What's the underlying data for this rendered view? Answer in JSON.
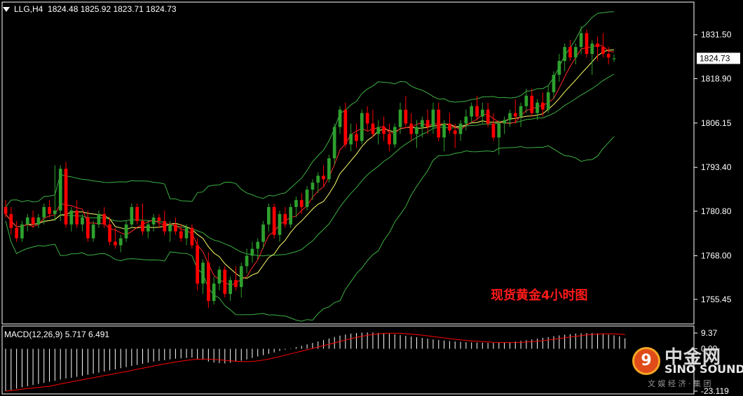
{
  "header": {
    "symbol": "LLG,H4",
    "ohlc": "1824.48 1825.92 1823.71 1824.73"
  },
  "caption": "现货黄金4小时图",
  "macd": {
    "label": "MACD(12,26,9) 5.717 6.491",
    "axis_top": "9.37",
    "axis_zero": "0.00",
    "axis_bottom": "-23.119"
  },
  "logo": {
    "cn": "中金网",
    "en": "SINO SOUND",
    "sub": "文 娱 经 济 · 集 团"
  },
  "colors": {
    "background": "#000000",
    "bull_candle": "#2ea02e",
    "bear_candle": "#ff0000",
    "bollinger": "#3cb043",
    "ma_fast": "#ff2a2a",
    "ma_slow": "#ffff66",
    "macd_hist": "#ffffff",
    "macd_signal": "#ff0000",
    "current_price_box": "#ffffff"
  },
  "chart_data": {
    "type": "candlestick",
    "timeframe": "H4",
    "y_ticks": [
      1831.5,
      1818.9,
      1806.15,
      1793.4,
      1780.8,
      1768.0,
      1755.45
    ],
    "ylim": [
      1748.4,
      1840.9
    ],
    "current_price": 1824.73,
    "candles": [
      [
        1782,
        1784,
        1779,
        1780
      ],
      [
        1780,
        1782,
        1774,
        1776
      ],
      [
        1776,
        1778,
        1772,
        1773
      ],
      [
        1773,
        1778,
        1772,
        1777
      ],
      [
        1777,
        1780,
        1775,
        1779
      ],
      [
        1779,
        1781,
        1776,
        1777
      ],
      [
        1777,
        1780,
        1776,
        1779
      ],
      [
        1779,
        1783,
        1777,
        1782
      ],
      [
        1782,
        1784,
        1779,
        1780
      ],
      [
        1780,
        1794,
        1778,
        1781
      ],
      [
        1781,
        1794,
        1778,
        1793
      ],
      [
        1793,
        1795,
        1776,
        1777
      ],
      [
        1777,
        1782,
        1775,
        1781
      ],
      [
        1781,
        1784,
        1776,
        1777
      ],
      [
        1777,
        1780,
        1775,
        1779
      ],
      [
        1779,
        1781,
        1772,
        1773
      ],
      [
        1773,
        1778,
        1772,
        1777
      ],
      [
        1777,
        1781,
        1776,
        1780
      ],
      [
        1780,
        1782,
        1776,
        1777
      ],
      [
        1777,
        1779,
        1771,
        1772
      ],
      [
        1772,
        1776,
        1770,
        1771
      ],
      [
        1771,
        1774,
        1769,
        1773
      ],
      [
        1773,
        1778,
        1772,
        1777
      ],
      [
        1777,
        1783,
        1776,
        1782
      ],
      [
        1782,
        1783,
        1777,
        1778
      ],
      [
        1778,
        1783,
        1774,
        1775
      ],
      [
        1775,
        1778,
        1773,
        1777
      ],
      [
        1777,
        1780,
        1775,
        1779
      ],
      [
        1779,
        1780,
        1776,
        1778
      ],
      [
        1778,
        1781,
        1774,
        1775
      ],
      [
        1775,
        1778,
        1772,
        1777
      ],
      [
        1777,
        1779,
        1774,
        1775
      ],
      [
        1775,
        1777,
        1772,
        1773
      ],
      [
        1773,
        1777,
        1771,
        1776
      ],
      [
        1776,
        1777,
        1770,
        1771
      ],
      [
        1771,
        1773,
        1758,
        1760
      ],
      [
        1760,
        1767,
        1757,
        1766
      ],
      [
        1766,
        1769,
        1753,
        1755
      ],
      [
        1755,
        1762,
        1754,
        1760
      ],
      [
        1760,
        1765,
        1758,
        1764
      ],
      [
        1764,
        1765,
        1756,
        1757
      ],
      [
        1757,
        1762,
        1755,
        1761
      ],
      [
        1761,
        1765,
        1758,
        1759
      ],
      [
        1759,
        1766,
        1756,
        1765
      ],
      [
        1765,
        1770,
        1763,
        1768
      ],
      [
        1768,
        1772,
        1766,
        1770
      ],
      [
        1770,
        1773,
        1767,
        1772
      ],
      [
        1772,
        1778,
        1770,
        1777
      ],
      [
        1777,
        1783,
        1775,
        1782
      ],
      [
        1782,
        1783,
        1773,
        1774
      ],
      [
        1774,
        1781,
        1772,
        1780
      ],
      [
        1780,
        1782,
        1776,
        1777
      ],
      [
        1777,
        1783,
        1776,
        1782
      ],
      [
        1782,
        1785,
        1779,
        1784
      ],
      [
        1784,
        1786,
        1780,
        1782
      ],
      [
        1782,
        1788,
        1781,
        1787
      ],
      [
        1787,
        1790,
        1784,
        1789
      ],
      [
        1789,
        1792,
        1786,
        1791
      ],
      [
        1791,
        1794,
        1788,
        1790
      ],
      [
        1790,
        1797,
        1789,
        1796
      ],
      [
        1796,
        1806,
        1794,
        1805
      ],
      [
        1805,
        1811,
        1803,
        1810
      ],
      [
        1810,
        1812,
        1799,
        1800
      ],
      [
        1800,
        1806,
        1798,
        1803
      ],
      [
        1803,
        1806,
        1799,
        1801
      ],
      [
        1801,
        1810,
        1800,
        1809
      ],
      [
        1809,
        1811,
        1804,
        1806
      ],
      [
        1806,
        1810,
        1802,
        1803
      ],
      [
        1803,
        1807,
        1800,
        1805
      ],
      [
        1805,
        1808,
        1801,
        1803
      ],
      [
        1803,
        1806,
        1798,
        1800
      ],
      [
        1800,
        1806,
        1799,
        1805
      ],
      [
        1805,
        1812,
        1803,
        1810
      ],
      [
        1810,
        1814,
        1805,
        1806
      ],
      [
        1806,
        1809,
        1801,
        1803
      ],
      [
        1803,
        1807,
        1799,
        1805
      ],
      [
        1805,
        1808,
        1802,
        1807
      ],
      [
        1807,
        1810,
        1803,
        1805
      ],
      [
        1805,
        1812,
        1803,
        1810
      ],
      [
        1810,
        1812,
        1801,
        1802
      ],
      [
        1802,
        1807,
        1798,
        1806
      ],
      [
        1806,
        1809,
        1803,
        1804
      ],
      [
        1804,
        1806,
        1799,
        1803
      ],
      [
        1803,
        1807,
        1801,
        1806
      ],
      [
        1806,
        1810,
        1804,
        1808
      ],
      [
        1808,
        1812,
        1806,
        1811
      ],
      [
        1811,
        1814,
        1807,
        1808
      ],
      [
        1808,
        1812,
        1806,
        1810
      ],
      [
        1810,
        1812,
        1805,
        1806
      ],
      [
        1806,
        1809,
        1801,
        1802
      ],
      [
        1802,
        1807,
        1797,
        1806
      ],
      [
        1806,
        1808,
        1803,
        1807
      ],
      [
        1807,
        1810,
        1805,
        1809
      ],
      [
        1809,
        1813,
        1806,
        1808
      ],
      [
        1808,
        1812,
        1805,
        1811
      ],
      [
        1811,
        1816,
        1809,
        1814
      ],
      [
        1814,
        1816,
        1808,
        1809
      ],
      [
        1809,
        1813,
        1807,
        1812
      ],
      [
        1812,
        1815,
        1808,
        1810
      ],
      [
        1810,
        1817,
        1809,
        1815
      ],
      [
        1815,
        1821,
        1813,
        1820
      ],
      [
        1820,
        1826,
        1818,
        1824
      ],
      [
        1824,
        1829,
        1821,
        1828
      ],
      [
        1828,
        1830,
        1824,
        1825
      ],
      [
        1825,
        1829,
        1823,
        1828
      ],
      [
        1828,
        1834,
        1826,
        1832
      ],
      [
        1832,
        1833,
        1825,
        1826
      ],
      [
        1826,
        1830,
        1820,
        1829
      ],
      [
        1829,
        1831,
        1824,
        1828
      ],
      [
        1828,
        1832,
        1825,
        1826
      ],
      [
        1826,
        1828,
        1823,
        1825
      ],
      [
        1824.48,
        1825.92,
        1823.71,
        1824.73
      ]
    ],
    "series_labels": [
      "Bollinger upper",
      "Bollinger middle",
      "Bollinger lower",
      "MA fast",
      "MA slow"
    ],
    "macd_values": [
      -23.1,
      -22.5,
      -21.8,
      -21,
      -20.4,
      -19.8,
      -19.2,
      -18.6,
      -18,
      -17.5,
      -16.8,
      -16.2,
      -15.8,
      -15.3,
      -14.8,
      -14.2,
      -13.6,
      -13,
      -12.4,
      -11.8,
      -11.2,
      -10.6,
      -10,
      -9.4,
      -8.8,
      -8.2,
      -7.6,
      -7,
      -6.6,
      -6.2,
      -5.8,
      -5.4,
      -5.2,
      -5,
      -4.8,
      -5.5,
      -6,
      -7,
      -7.5,
      -7.8,
      -8,
      -7.6,
      -7,
      -6.5,
      -5.8,
      -5,
      -4.2,
      -3.5,
      -2.8,
      -2,
      -1.2,
      -0.5,
      0.2,
      0.9,
      1.6,
      2.4,
      3.2,
      4,
      4.8,
      5.6,
      6.4,
      7.2,
      7.8,
      8.3,
      8.6,
      8.8,
      8.9,
      8.9,
      8.7,
      8.5,
      8.2,
      7.9,
      7.5,
      7.1,
      6.7,
      6.3,
      5.9,
      5.5,
      5.1,
      4.8,
      4.5,
      4.2,
      4,
      3.8,
      3.6,
      3.5,
      3.4,
      3.3,
      3.2,
      3.2,
      3.3,
      3.5,
      3.7,
      4,
      4.3,
      4.7,
      5.1,
      5.5,
      6,
      6.4,
      6.9,
      7.3,
      7.7,
      8,
      8.3,
      8.5,
      8.6,
      8.6,
      8.4,
      8.1,
      7.7,
      7.3,
      6.8,
      5.7
    ],
    "macd_ylim": [
      -23.119,
      9.37
    ]
  }
}
